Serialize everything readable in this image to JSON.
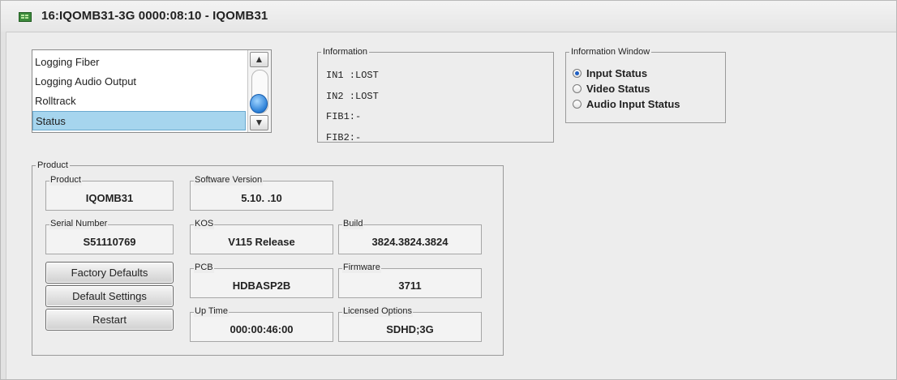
{
  "window": {
    "title": "16:IQOMB31-3G  0000:08:10  - IQOMB31",
    "icon": "module-board-icon"
  },
  "menu_list": {
    "items": [
      "Logging Fiber",
      "Logging Audio Output",
      "Rolltrack",
      "Status"
    ],
    "selected": "Status"
  },
  "information": {
    "legend": "Information",
    "lines": [
      "IN1 :LOST",
      "IN2 :LOST",
      "FIB1:-",
      "FIB2:-"
    ]
  },
  "information_window": {
    "legend": "Information Window",
    "options": [
      "Input Status",
      "Video Status",
      "Audio Input Status"
    ],
    "selected": "Input Status"
  },
  "product": {
    "legend": "Product",
    "fields": {
      "product": {
        "label": "Product",
        "value": "IQOMB31"
      },
      "software_version": {
        "label": "Software Version",
        "value": "5.10. .10"
      },
      "serial_number": {
        "label": "Serial Number",
        "value": "S51110769"
      },
      "kos": {
        "label": "KOS",
        "value": "V115 Release"
      },
      "build": {
        "label": "Build",
        "value": "3824.3824.3824"
      },
      "pcb": {
        "label": "PCB",
        "value": "HDBASP2B"
      },
      "firmware": {
        "label": "Firmware",
        "value": "3711"
      },
      "up_time": {
        "label": "Up Time",
        "value": "000:00:46:00"
      },
      "licensed_options": {
        "label": "Licensed Options",
        "value": "SDHD;3G"
      }
    },
    "buttons": {
      "factory_defaults": "Factory Defaults",
      "default_settings": "Default Settings",
      "restart": "Restart"
    }
  },
  "colors": {
    "selection": "#a6d5ee",
    "radio_on": "#1e5fc4",
    "scroll_thumb": "#2b7fd6"
  }
}
